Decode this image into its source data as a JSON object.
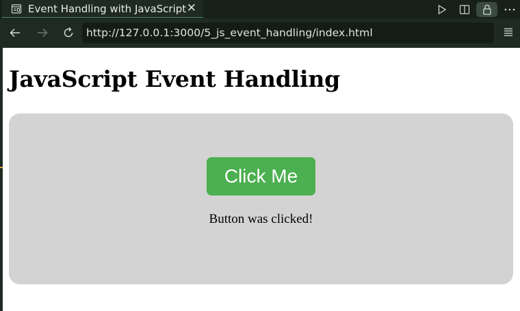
{
  "browser": {
    "tab_title": "Event Handling with JavaScript",
    "tab_icon": "page-icon",
    "address": "http://127.0.0.1:3000/5_js_event_handling/index.html",
    "accent": "#4a8c6c"
  },
  "page": {
    "heading": "JavaScript Event Handling",
    "button_label": "Click Me",
    "status_text": "Button was clicked!",
    "button_color": "#4caf50",
    "card_color": "#d3d3d3"
  }
}
